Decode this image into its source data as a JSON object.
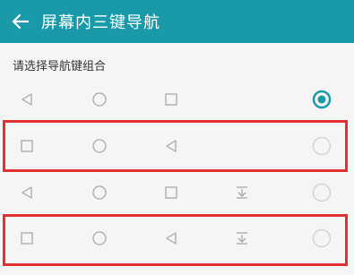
{
  "header": {
    "title": "屏幕内三键导航",
    "back_icon": "back-arrow-icon"
  },
  "section": {
    "label": "请选择导航键组合"
  },
  "options": [
    {
      "keys": [
        "back-triangle-icon",
        "home-circle-icon",
        "recent-square-icon"
      ],
      "selected": true
    },
    {
      "keys": [
        "recent-square-icon",
        "home-circle-icon",
        "back-triangle-icon"
      ],
      "selected": false
    },
    {
      "keys": [
        "back-triangle-icon",
        "home-circle-icon",
        "recent-square-icon",
        "notification-pulldown-icon"
      ],
      "selected": false
    },
    {
      "keys": [
        "recent-square-icon",
        "home-circle-icon",
        "back-triangle-icon",
        "notification-pulldown-icon"
      ],
      "selected": false
    }
  ],
  "colors": {
    "accent": "#1a9aa8",
    "highlight": "#e03030",
    "icon": "#a8a8a8"
  }
}
